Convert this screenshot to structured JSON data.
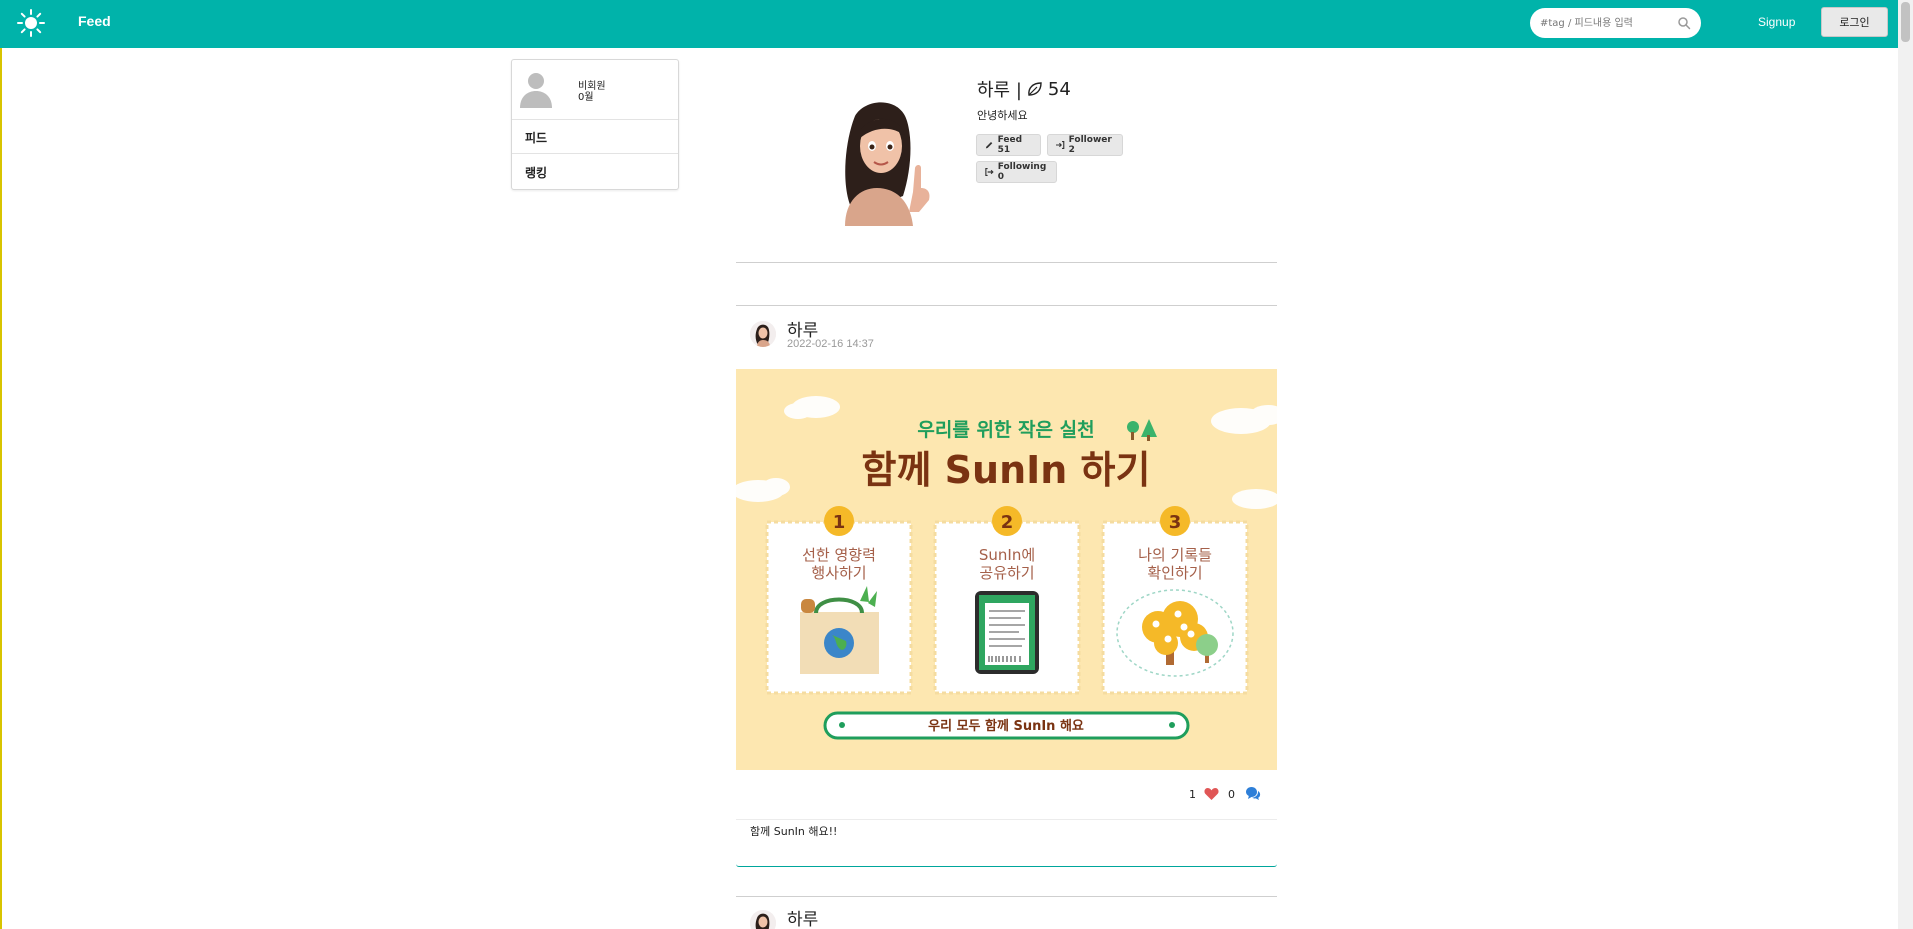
{
  "navbar": {
    "brand": "Feed",
    "search_placeholder": "#tag / 피드내용 입력",
    "signup_label": "Signup",
    "login_label": "로그인",
    "color": "#00b3aa"
  },
  "sidebar": {
    "user_name": "비회원",
    "user_points": "0월",
    "items": [
      {
        "label": "피드"
      },
      {
        "label": "랭킹"
      }
    ]
  },
  "profile": {
    "name": "하루 |",
    "points": "54",
    "bio": "안녕하세요",
    "buttons": {
      "feed": "Feed 51",
      "follower": "Follower 2",
      "following": "Following 0"
    }
  },
  "post": {
    "author": "하루",
    "date": "2022-02-16 14:37",
    "image": {
      "subtitle": "우리를 위한 작은 실천",
      "title": "함께 SunIn 하기",
      "steps": [
        {
          "num": "1",
          "line1": "선한 영향력",
          "line2": "행사하기"
        },
        {
          "num": "2",
          "line1": "SunIn에",
          "line2": "공유하기"
        },
        {
          "num": "3",
          "line1": "나의 기록들",
          "line2": "확인하기"
        }
      ],
      "banner": "우리 모두 함께 SunIn 해요"
    },
    "likes": "1",
    "comments": "0",
    "text": "함께 SunIn 해요!!",
    "heart_color": "#e05656",
    "comment_color": "#2e7fd8"
  },
  "post2": {
    "author": "하루"
  }
}
